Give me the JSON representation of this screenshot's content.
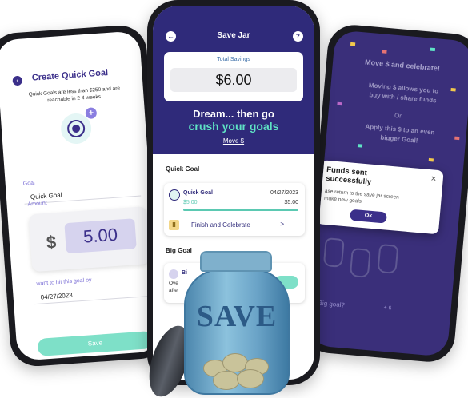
{
  "left_screen": {
    "title": "Create Quick Goal",
    "back_icon": "chevron-left-icon",
    "description": "Quick Goals are less than $250 and are reachable in 2-4 weeks.",
    "goal_label": "Goal",
    "goal_value": "Quick Goal",
    "amount_label": "Amount",
    "currency_symbol": "$",
    "amount_value": "5.00",
    "date_label": "I want to hit this goal by",
    "date_value": "04/27/2023",
    "save_label": "Save"
  },
  "center_screen": {
    "title": "Save Jar",
    "back_icon": "chevron-left-icon",
    "help_icon": "question-icon",
    "total_savings_label": "Total Savings",
    "total_savings_value": "$6.00",
    "tagline_1": "Dream... then go",
    "tagline_2": "crush your goals",
    "move_link": "Move $",
    "quick_goal_section": "Quick Goal",
    "quick_goal": {
      "name": "Quick Goal",
      "date": "04/27/2023",
      "current": "$5.00",
      "target": "$5.00",
      "progress": 1.0,
      "finish_label": "Finish and Celebrate",
      "finish_arrow": ">"
    },
    "big_goal_section": "Big Goal",
    "big_goal": {
      "name_partial": "Bi",
      "line1_partial": "Ove",
      "line2_partial": "afte"
    }
  },
  "right_screen": {
    "header_partial": "Move $ and celebrate!",
    "line1": "Moving $ allows you to",
    "line2": "buy with / share funds",
    "or_text": "Or",
    "line3": "Apply this $ to an even",
    "line4": "bigger Goal!",
    "modal": {
      "title_line1": "Funds sent",
      "title_line2": "successfully",
      "close_icon": "close-icon",
      "body_line1": "ase return to the save jar screen",
      "body_line2": "make new goals",
      "ok_label": "Ok"
    },
    "link_partial": "Big goal?",
    "plus_text": "+ 6"
  },
  "jar": {
    "label": "SAVE"
  },
  "colors": {
    "brand_purple": "#2f2a7a",
    "accent_teal": "#5fe3c5",
    "button_mint": "#7ee0c8"
  }
}
